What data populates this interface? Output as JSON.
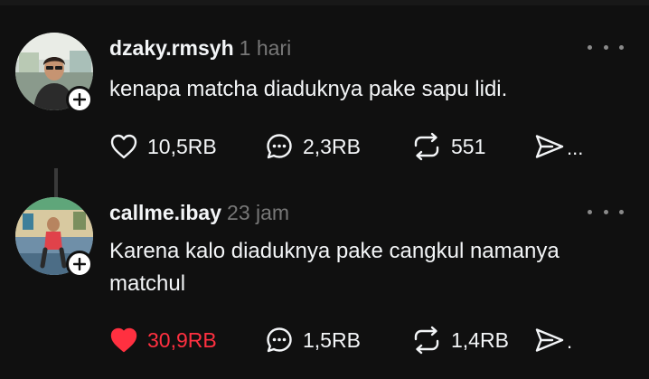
{
  "colors": {
    "background": "#101010",
    "text_primary": "#f3f5f7",
    "text_secondary": "#777777",
    "liked_red": "#ff3040"
  },
  "posts": [
    {
      "username": "dzaky.rmsyh",
      "time": "1 hari",
      "text": "kenapa matcha diaduknya pake sapu lidi.",
      "likes": "10,5RB",
      "liked": false,
      "replies": "2,3RB",
      "reposts": "551",
      "share_ellipsis": "...",
      "icons": [
        "heart-icon",
        "comment-icon",
        "repost-icon",
        "send-icon",
        "plus-icon",
        "more-icon"
      ]
    },
    {
      "username": "callme.ibay",
      "time": "23 jam",
      "text": "Karena kalo diaduknya pake cangkul namanya matchul",
      "likes": "30,9RB",
      "liked": true,
      "replies": "1,5RB",
      "reposts": "1,4RB",
      "share_ellipsis": ".",
      "icons": [
        "heart-filled-icon",
        "comment-icon",
        "repost-icon",
        "send-icon",
        "plus-icon",
        "more-icon"
      ]
    }
  ]
}
